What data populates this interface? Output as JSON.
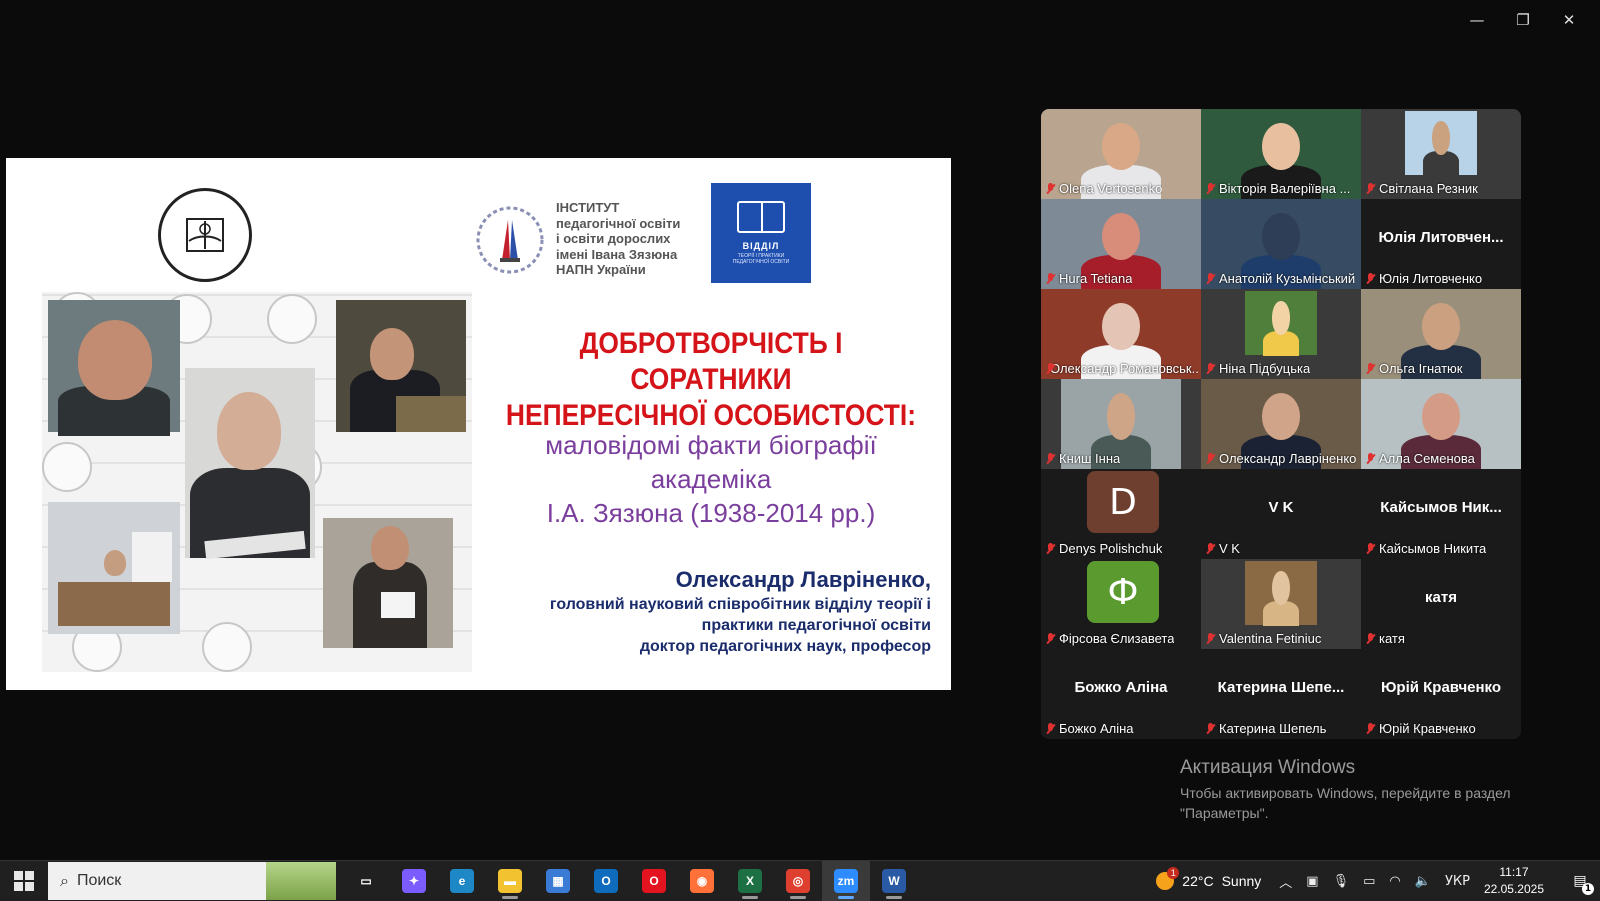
{
  "window": {
    "controls": [
      "—",
      "❐",
      "✕"
    ]
  },
  "slide": {
    "institute_lines": "ІНСТИТУТ\nпедагогічної освіти\nі освіти дорослих\nімені Івана Зязюна\nНАПН України",
    "dept_logo_label": "ВІДДІЛ",
    "dept_logo_sub": "ТЕОРІЇ І ПРАКТИКИ ПЕДАГОГІЧНОЇ ОСВІТИ",
    "title_line1": "ДОБРОТВОРЧІСТЬ І СОРАТНИКИ",
    "title_line2": "НЕПЕРЕСІЧНОЇ ОСОБИСТОСТІ:",
    "subtitle_line1": "маловідомі факти біографії",
    "subtitle_line2": "академіка",
    "subtitle_line3": "І.А. Зязюна (1938-2014 рр.)",
    "author_name": "Олександр Лавріненко,",
    "author_line1": "головний науковий співробітник відділу теорії і",
    "author_line2": "практики педагогічної освіти",
    "author_line3": "доктор педагогічних наук, професор"
  },
  "participants": [
    {
      "name": "Olena Vertosenko",
      "mode": "video",
      "bg": "#b9a58f",
      "skin": "#d9a887",
      "shirt": "#e7e7ea"
    },
    {
      "name": "Вікторія Валеріївна ...",
      "mode": "video",
      "bg": "#2f5a3e",
      "skin": "#e8c0a0",
      "shirt": "#1a1a1a"
    },
    {
      "name": "Світлана Резник",
      "mode": "photo",
      "bg": "#b8d3e8",
      "skin": "#caa27f",
      "shirt": "#3a3a3a"
    },
    {
      "name": "Hura Tetiana",
      "mode": "video",
      "bg": "#7f8a97",
      "skin": "#d88d7a",
      "shirt": "#a51e2a"
    },
    {
      "name": "Анатолій Кузьмінський",
      "mode": "video",
      "bg": "#374c62",
      "skin": "#2e3e56",
      "shirt": "#1f3d6a"
    },
    {
      "name": "Юлія Литовченко",
      "mode": "text",
      "big": "Юлія Литовчен..."
    },
    {
      "name": "Олександр Романовськ...",
      "mode": "video",
      "bg": "#8f3b2a",
      "skin": "#e4c4b4",
      "shirt": "#f2f2f2"
    },
    {
      "name": "Ніна Підбуцька",
      "mode": "photo",
      "bg": "#4f7f3a",
      "skin": "#f2d3a6",
      "shirt": "#f0c84a"
    },
    {
      "name": "Ольга Ігнатюк",
      "mode": "video",
      "bg": "#9a8f7a",
      "skin": "#caa080",
      "shirt": "#233043"
    },
    {
      "name": "Книш Інна",
      "mode": "video",
      "bg": "#9aa4a6",
      "skin": "#cfa587",
      "shirt": "#4a5a56"
    },
    {
      "name": "Олександр Лавріненко",
      "mode": "video",
      "active": true,
      "bg": "#6a5a48",
      "skin": "#cfa488",
      "shirt": "#1a2233"
    },
    {
      "name": "Алла Семенова",
      "mode": "video",
      "bg": "#b7c1c3",
      "skin": "#d49c86",
      "shirt": "#5a2a3a"
    },
    {
      "name": "Denys Polishchuk",
      "mode": "avatar",
      "letter": "D",
      "color": "#6e3f2e"
    },
    {
      "name": "V K",
      "mode": "text",
      "big": "V K"
    },
    {
      "name": "Кайсымов Никита",
      "mode": "text",
      "big": "Кайсымов  Ник..."
    },
    {
      "name": "Фірсова Єлизавета",
      "mode": "avatar",
      "letter": "Ф",
      "color": "#5a9a2e"
    },
    {
      "name": "Valentina Fetiniuc",
      "mode": "photo",
      "bg": "#8a6a44",
      "skin": "#e2c39f",
      "shirt": "#d7b585"
    },
    {
      "name": "катя",
      "mode": "text",
      "big": "катя"
    },
    {
      "name": "Божко Аліна",
      "mode": "text",
      "big": "Божко Аліна"
    },
    {
      "name": "Катерина Шепель",
      "mode": "text",
      "big": "Катерина  Шепе..."
    },
    {
      "name": "Юрій Кравченко",
      "mode": "text",
      "big": "Юрій Кравченко"
    }
  ],
  "activation": {
    "heading": "Активация Windows",
    "line1": "Чтобы активировать Windows, перейдите в раздел",
    "line2": "\"Параметры\"."
  },
  "taskbar": {
    "search_placeholder": "Поиск",
    "apps": [
      {
        "icon": "task-view-icon",
        "color": "#202020",
        "glyph": "▭",
        "open": false
      },
      {
        "icon": "copilot-icon",
        "color": "#7b5cff",
        "glyph": "✦",
        "open": false
      },
      {
        "icon": "edge-icon",
        "color": "#1e88c7",
        "glyph": "e",
        "open": false
      },
      {
        "icon": "file-explorer-icon",
        "color": "#f2c231",
        "glyph": "▬",
        "open": true
      },
      {
        "icon": "store-icon",
        "color": "#3a7bd5",
        "glyph": "▦",
        "open": false
      },
      {
        "icon": "outlook-icon",
        "color": "#0f6cbd",
        "glyph": "O",
        "open": false
      },
      {
        "icon": "opera-icon",
        "color": "#e3141f",
        "glyph": "O",
        "open": false
      },
      {
        "icon": "firefox-icon",
        "color": "#ff7139",
        "glyph": "◉",
        "open": false
      },
      {
        "icon": "excel-icon",
        "color": "#1d7044",
        "glyph": "X",
        "open": true
      },
      {
        "icon": "chrome-icon",
        "color": "#de3f2e",
        "glyph": "◎",
        "open": true
      },
      {
        "icon": "zoom-icon",
        "color": "#2d8cff",
        "glyph": "zm",
        "open": true,
        "focus": true
      },
      {
        "icon": "word-icon",
        "color": "#2b5aa5",
        "glyph": "W",
        "open": true
      }
    ],
    "weather_temp": "22°C",
    "weather_cond": "Sunny",
    "weather_badge": "1",
    "lang": "УКР",
    "time": "11:17",
    "date": "22.05.2025",
    "notif_badge": "1"
  }
}
